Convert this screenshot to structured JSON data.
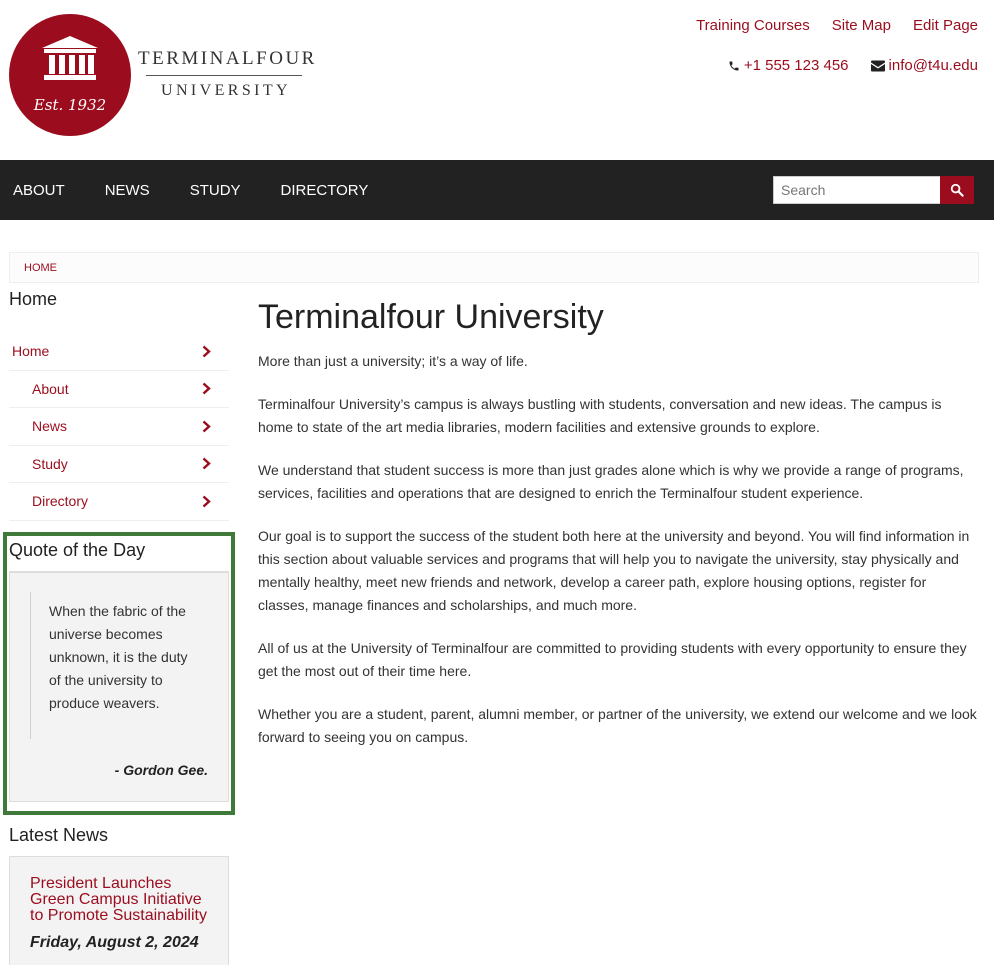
{
  "logo": {
    "est": "Est. 1932",
    "word_top": "TERMINALFOUR",
    "word_bottom": "UNIVERSITY"
  },
  "top_links": [
    "Training Courses",
    "Site Map",
    "Edit Page"
  ],
  "contact": {
    "phone": "+1 555 123 456",
    "email": "info@t4u.edu"
  },
  "nav": {
    "items": [
      "ABOUT",
      "NEWS",
      "STUDY",
      "DIRECTORY"
    ],
    "search_placeholder": "Search"
  },
  "breadcrumb": "HOME",
  "sidebar": {
    "title": "Home",
    "items": [
      {
        "label": "Home"
      },
      {
        "label": "About"
      },
      {
        "label": "News"
      },
      {
        "label": "Study"
      },
      {
        "label": "Directory"
      }
    ],
    "quote_title": "Quote of the Day",
    "quote_text": "When the fabric of the universe becomes unknown, it is the duty of the university to produce weavers.",
    "quote_author": "- Gordon Gee.",
    "news_title": "Latest News",
    "news_headline": "President Launches Green Campus Initiative to Promote Sustainability",
    "news_date": "Friday, August 2, 2024"
  },
  "main": {
    "title": "Terminalfour University",
    "paragraphs": [
      "More than just a university; it’s a way of life.",
      "Terminalfour University’s campus is always bustling with students, conversation and new ideas. The campus is home to state of the art media libraries, modern facilities and extensive grounds to explore.",
      "We understand that student success is more than just grades alone which is why we provide a range of programs, services, facilities and operations that are designed to enrich the Terminalfour student experience.",
      "Our goal is to support the success of the student both here at the university and beyond.  You will find information in this section about valuable services and programs that will help you to navigate the university, stay physically and mentally healthy, meet new friends and network, develop a career path, explore housing options, register for classes, manage finances and scholarships, and much more.",
      "All of us at the University of Terminalfour are committed to providing students with every opportunity to ensure they get the most out of their time here.",
      "Whether you are a student, parent, alumni member, or partner of the university, we extend our welcome and we look forward to seeing you on campus."
    ]
  },
  "colors": {
    "brand": "#9b0d1e",
    "navbar": "#222222",
    "highlight": "#3f7a3b"
  }
}
